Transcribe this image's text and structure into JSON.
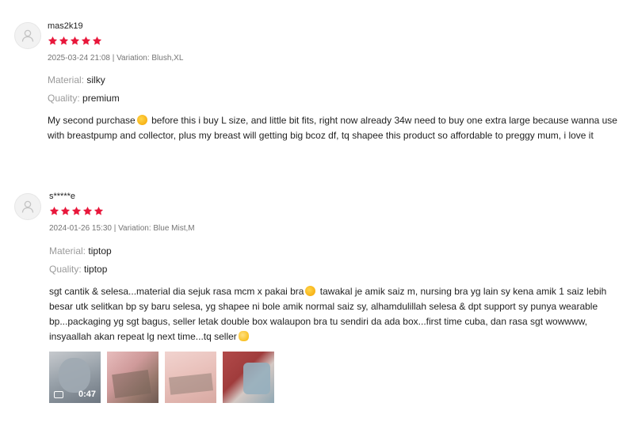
{
  "reviews": [
    {
      "username": "mas2k19",
      "rating": 5,
      "meta": "2025-03-24 21:08 | Variation: Blush,XL",
      "attributes": [
        {
          "label": "Material:",
          "value": "silky"
        },
        {
          "label": "Quality:",
          "value": "premium"
        }
      ],
      "text_parts": [
        "My second purchase",
        " before this i buy L size, and little bit fits, right now already 34w need to buy one extra large because wanna use",
        "with breastpump and collector, plus my breast will getting big bcoz df, tq shapee this product so affordable to preggy mum, i love it"
      ]
    },
    {
      "username": "s*****e",
      "rating": 5,
      "meta": "2024-01-26 15:30 | Variation: Blue Mist,M",
      "attributes": [
        {
          "label": "Material:",
          "value": "tiptop"
        },
        {
          "label": "Quality:",
          "value": "tiptop"
        }
      ],
      "text_parts": [
        "sgt cantik & selesa...material dia sejuk rasa mcm x pakai bra",
        " tawakal je amik saiz m, nursing bra yg lain sy kena amik 1 saiz lebih",
        "besar utk selitkan bp sy baru selesa, yg shapee ni bole amik normal saiz sy, alhamdulillah selesa & dpt support sy punya wearable",
        "bp...packaging yg sgt bagus, seller letak double box walaupon bra tu sendiri da ada box...first time cuba, dan rasa sgt wowwww,",
        "insyaallah akan repeat lg next time...tq seller"
      ],
      "media": [
        {
          "type": "video",
          "duration": "0:47"
        },
        {
          "type": "image"
        },
        {
          "type": "image"
        },
        {
          "type": "image"
        }
      ]
    }
  ],
  "colors": {
    "star": "#e8173b",
    "meta_text": "#757575",
    "label_text": "#9a9a9a"
  }
}
